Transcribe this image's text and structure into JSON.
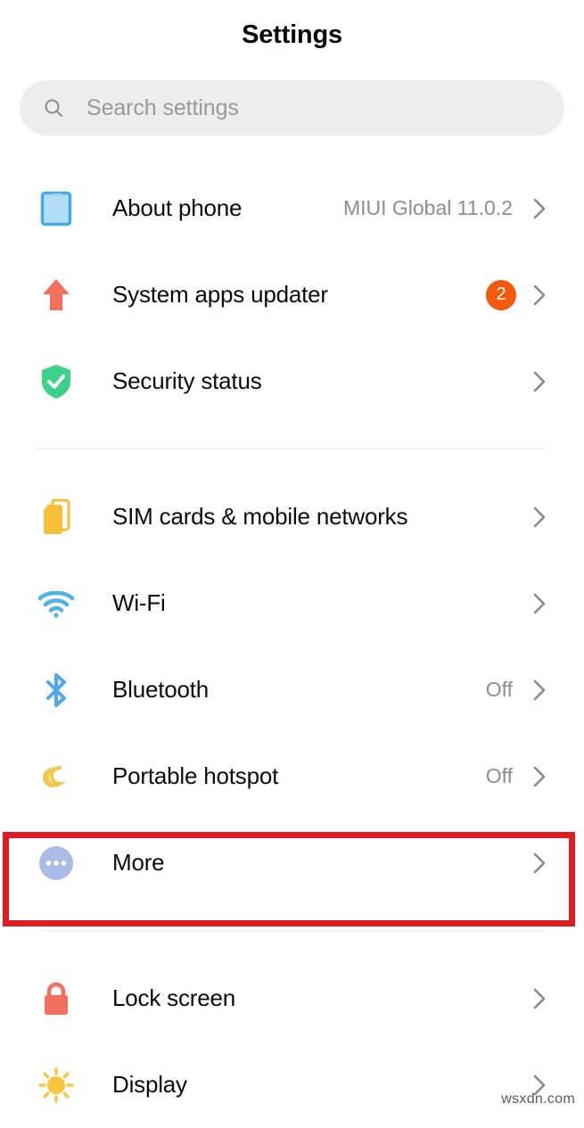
{
  "header": {
    "title": "Settings"
  },
  "search": {
    "icon": "search-icon",
    "placeholder": "Search settings",
    "value": ""
  },
  "groups": [
    {
      "name": "device-info-group",
      "items": [
        {
          "label": "About phone",
          "value": "MIUI Global 11.0.2",
          "badge": "",
          "icon": "phone-icon",
          "icon_color": "#a8d5f5",
          "chevron": "chevron-right-icon",
          "highlighted": false
        },
        {
          "label": "System apps updater",
          "value": "",
          "badge": "2",
          "icon": "up-arrow-icon",
          "icon_color": "#f4705e",
          "chevron": "chevron-right-icon",
          "highlighted": false
        },
        {
          "label": "Security status",
          "value": "",
          "badge": "",
          "icon": "shield-check-icon",
          "icon_color": "#3ed18b",
          "chevron": "chevron-right-icon",
          "highlighted": false
        }
      ]
    },
    {
      "name": "connectivity-group",
      "items": [
        {
          "label": "SIM cards & mobile networks",
          "value": "",
          "badge": "",
          "icon": "sim-card-icon",
          "icon_color": "#f8bf39",
          "chevron": "chevron-right-icon",
          "highlighted": false
        },
        {
          "label": "Wi-Fi",
          "value": "",
          "badge": "",
          "icon": "wifi-icon",
          "icon_color": "#4fb3e8",
          "chevron": "chevron-right-icon",
          "highlighted": false
        },
        {
          "label": "Bluetooth",
          "value": "Off",
          "badge": "",
          "icon": "bluetooth-icon",
          "icon_color": "#4fa8ec",
          "chevron": "chevron-right-icon",
          "highlighted": false
        },
        {
          "label": "Portable hotspot",
          "value": "Off",
          "badge": "",
          "icon": "hotspot-icon",
          "icon_color": "#f5c64c",
          "chevron": "chevron-right-icon",
          "highlighted": false
        },
        {
          "label": "More",
          "value": "",
          "badge": "",
          "icon": "more-dots-icon",
          "icon_color": "#aabbe8",
          "chevron": "chevron-right-icon",
          "highlighted": true
        }
      ]
    },
    {
      "name": "personalization-group",
      "items": [
        {
          "label": "Lock screen",
          "value": "",
          "badge": "",
          "icon": "lock-icon",
          "icon_color": "#f4705e",
          "chevron": "chevron-right-icon",
          "highlighted": false
        },
        {
          "label": "Display",
          "value": "",
          "badge": "",
          "icon": "brightness-sun-icon",
          "icon_color": "#f8c53c",
          "chevron": "chevron-right-icon",
          "highlighted": false
        }
      ]
    }
  ],
  "annotation": {
    "target_label": "More",
    "color": "#e01b22"
  },
  "watermark": {
    "text": "wsxdn.com"
  }
}
